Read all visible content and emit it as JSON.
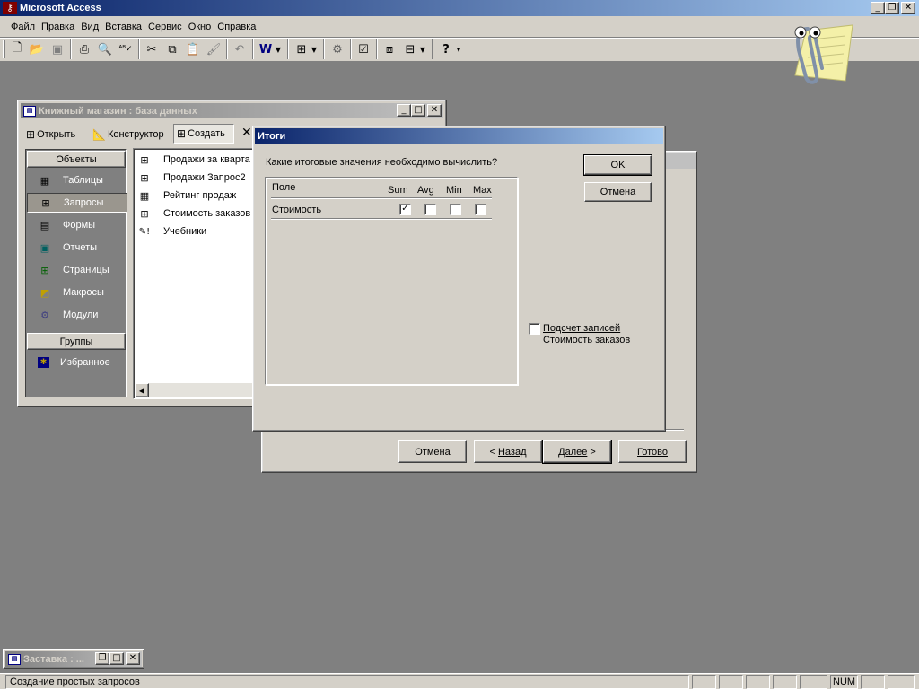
{
  "app": {
    "title": "Microsoft Access"
  },
  "menubar": {
    "items": [
      {
        "label": "Файл"
      },
      {
        "label": "Правка"
      },
      {
        "label": "Вид"
      },
      {
        "label": "Вставка"
      },
      {
        "label": "Сервис"
      },
      {
        "label": "Окно"
      },
      {
        "label": "Справка"
      }
    ]
  },
  "toolbar": {
    "buttons": [
      "new-icon",
      "open-icon",
      "save-icon",
      "print-icon",
      "preview-icon",
      "spelling-icon",
      "cut-icon",
      "copy-icon",
      "paste-icon",
      "format-painter-icon",
      "undo-icon",
      "office-links-icon",
      "analyze-icon",
      "code-icon",
      "properties-icon",
      "relationships-icon",
      "new-object-icon",
      "help-icon"
    ]
  },
  "db_window": {
    "title": "Книжный магазин : база данных",
    "toolbar": {
      "open": "Открыть",
      "design": "Конструктор",
      "create": "Создать"
    },
    "objects_header": "Объекты",
    "groups_header": "Группы",
    "objects": [
      {
        "label": "Таблицы"
      },
      {
        "label": "Запросы"
      },
      {
        "label": "Формы"
      },
      {
        "label": "Отчеты"
      },
      {
        "label": "Страницы"
      },
      {
        "label": "Макросы"
      },
      {
        "label": "Модули"
      }
    ],
    "favorites": "Избранное",
    "list": [
      {
        "label": "Продажи за кварта"
      },
      {
        "label": "Продажи Запрос2"
      },
      {
        "label": "Рейтинг продаж"
      },
      {
        "label": "Стоимость заказов"
      },
      {
        "label": "Учебники"
      }
    ]
  },
  "wizard": {
    "cancel": "Отмена",
    "back_prefix": "< ",
    "back": "Назад",
    "next": "Далее",
    "next_suffix": " >",
    "finish": "Готово"
  },
  "totals_dialog": {
    "title": "Итоги",
    "question": "Какие итоговые значения необходимо вычислить?",
    "ok": "OK",
    "cancel": "Отмена",
    "table": {
      "field_header": "Поле",
      "columns": [
        "Sum",
        "Avg",
        "Min",
        "Max"
      ],
      "rows": [
        {
          "field": "Стоимость",
          "sum": true,
          "avg": false,
          "min": false,
          "max": false
        }
      ]
    },
    "count_records": {
      "label": "Подсчет записей",
      "table_name": "Стоимость заказов",
      "checked": false
    }
  },
  "minimized_window": {
    "title": "Заставка : ..."
  },
  "statusbar": {
    "text": "Создание простых запросов",
    "num": "NUM"
  },
  "colors": {
    "desktop": "#808080",
    "face": "#d4d0c8",
    "active_caption": "#0a246a",
    "gradient": "#a6caf0"
  }
}
